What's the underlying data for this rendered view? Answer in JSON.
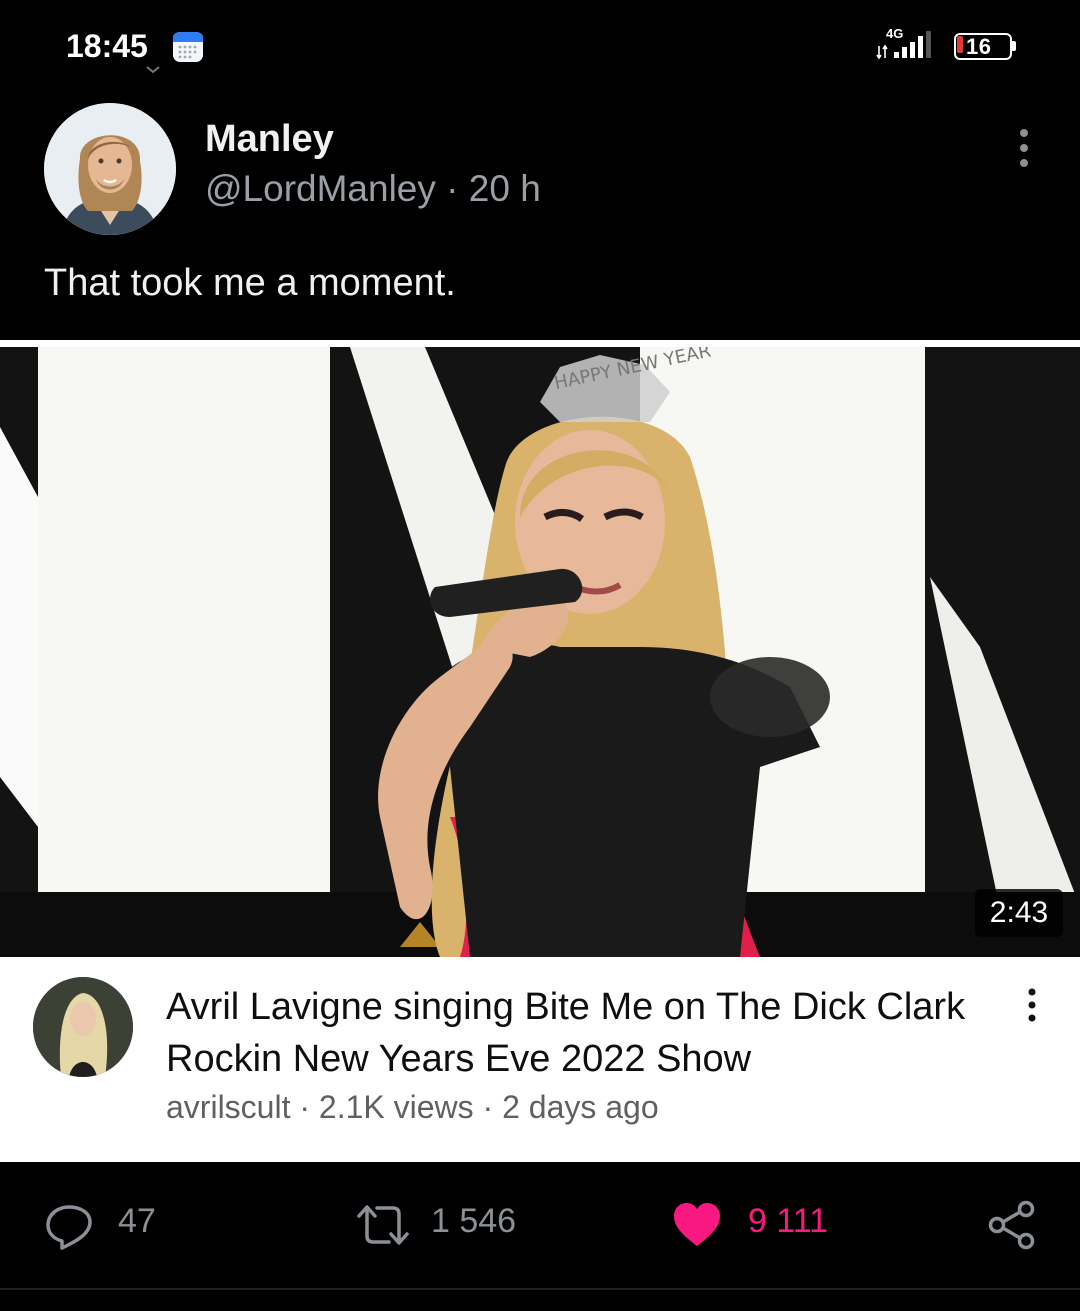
{
  "status_bar": {
    "time": "18:45",
    "network": "4G",
    "battery": "16",
    "colors": {
      "battery_low": "#e53935"
    }
  },
  "tweet": {
    "display_name": "Manley",
    "handle": "@LordManley",
    "separator": "·",
    "age": "20 h",
    "text": "That took me a moment."
  },
  "embed": {
    "video_overlay_text": "HAPPY NEW YEAR",
    "duration": "2:43",
    "title": "Avril Lavigne singing Bite Me on The Dick Clark Rockin New Years Eve 2022 Show",
    "channel": "avrilscult",
    "views": "2.1K views",
    "posted": "2 days ago",
    "meta_separator": "·"
  },
  "actions": {
    "replies": "47",
    "retweets": "1 546",
    "likes": "9 111",
    "like_color": "#f91880",
    "icons": [
      "reply-icon",
      "retweet-icon",
      "heart-icon",
      "share-icon"
    ]
  }
}
